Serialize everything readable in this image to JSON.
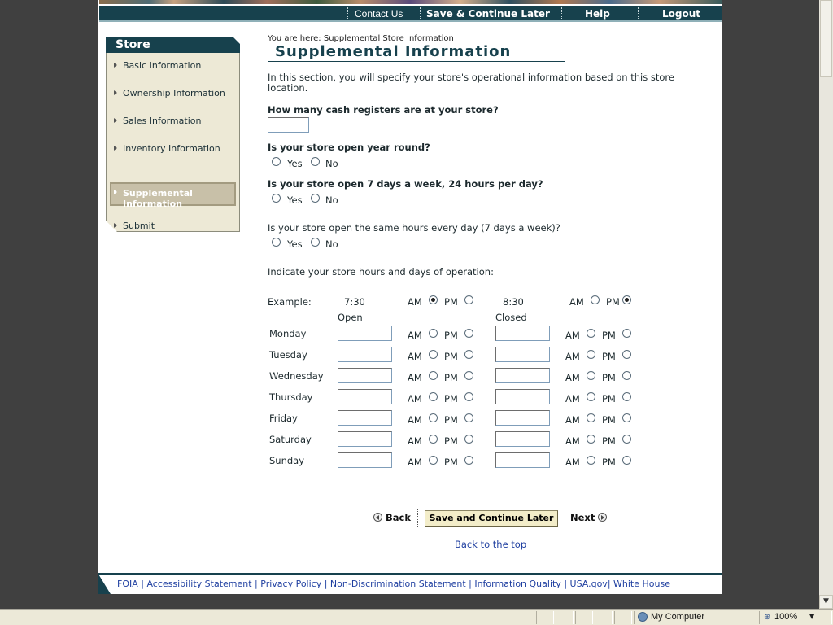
{
  "nav": {
    "contact_us": "Contact Us",
    "save_continue": "Save & Continue Later",
    "help": "Help",
    "logout": "Logout"
  },
  "sidebar": {
    "title": "Store",
    "items": [
      {
        "label": "Basic Information"
      },
      {
        "label": "Ownership Information"
      },
      {
        "label": "Sales Information"
      },
      {
        "label": "Inventory Information"
      },
      {
        "label": "Supplemental Information"
      },
      {
        "label": "Submit"
      }
    ],
    "active_index": 4
  },
  "breadcrumb": "You are here: Supplemental Store Information",
  "page_title": "Supplemental Information",
  "intro": "In this section, you will specify your store's operational information based on this store location.",
  "questions": {
    "registers": "How many cash registers are at your store?",
    "year_round": "Is your store open year round?",
    "always_open": "Is your store open 7 days a week, 24 hours per day?",
    "same_hours": "Is your store open the same hours every day (7 days a week)?",
    "yes": "Yes",
    "no": "No"
  },
  "hours": {
    "instruction": "Indicate your store hours and days of operation:",
    "example_label": "Example:",
    "example_open_time": "7:30",
    "example_open_ampm": "AM",
    "example_close_time": "8:30",
    "example_close_ampm": "PM",
    "open_header": "Open",
    "closed_header": "Closed",
    "am": "AM",
    "pm": "PM",
    "days": [
      "Monday",
      "Tuesday",
      "Wednesday",
      "Thursday",
      "Friday",
      "Saturday",
      "Sunday"
    ]
  },
  "buttons": {
    "back": "Back",
    "save_later": "Save and Continue Later",
    "next": "Next",
    "back_to_top": "Back to the top"
  },
  "footer": [
    "FOIA",
    "Accessibility Statement",
    "Privacy Policy",
    "Non-Discrimination Statement",
    "Information Quality",
    "USA.gov",
    "White House"
  ],
  "status": {
    "zone": "My Computer",
    "zoom": "100%"
  },
  "colors": {
    "header": "#17414d",
    "sidebar_bg": "#ede9d6",
    "link": "#1f3fa0",
    "button_bg": "#f3edc9"
  }
}
